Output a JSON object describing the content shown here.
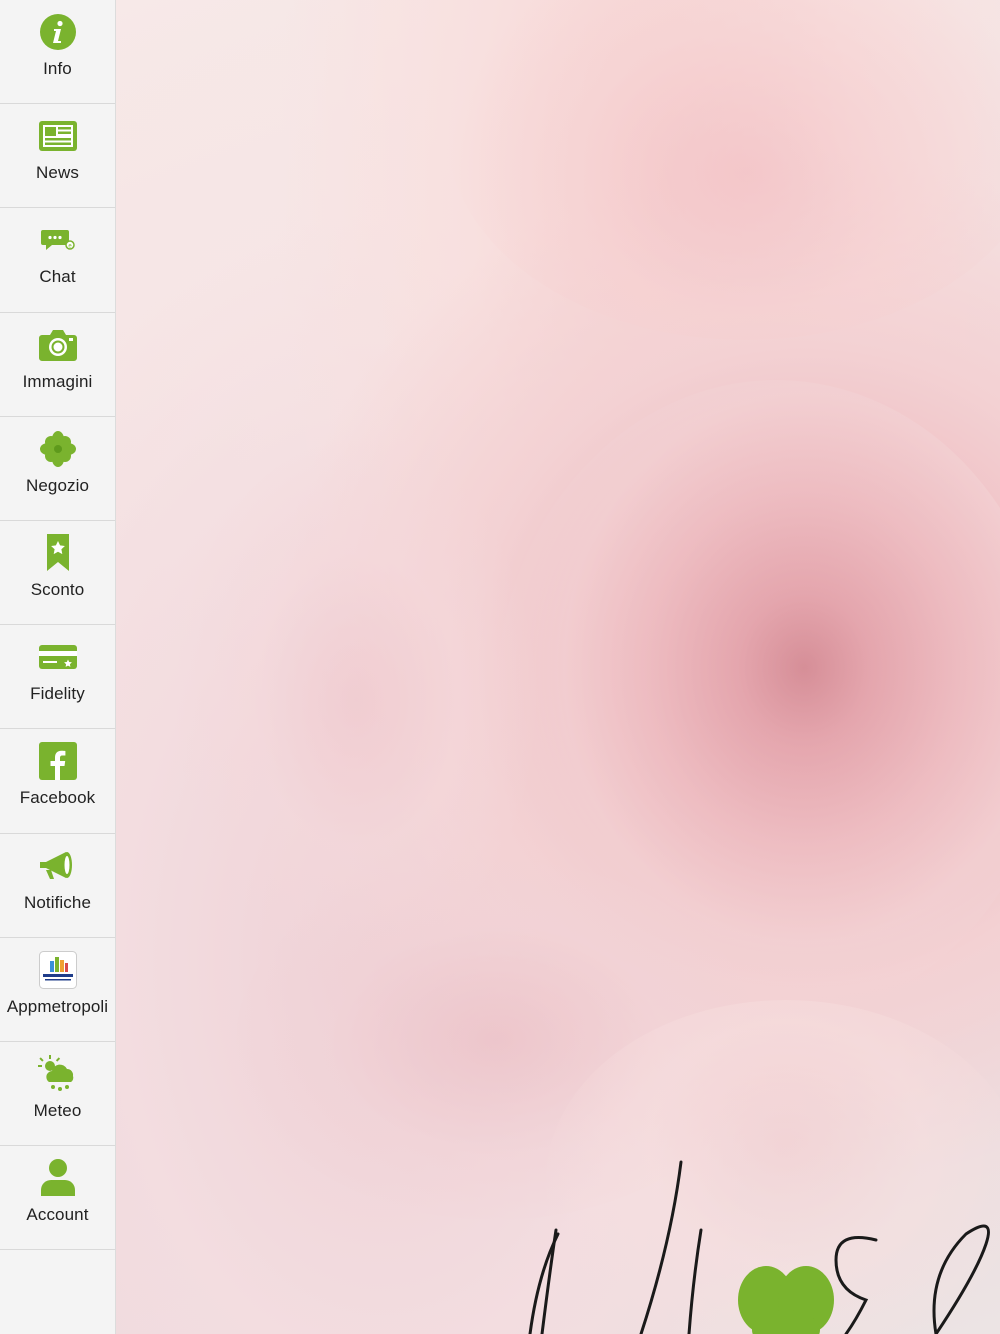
{
  "sidebar": {
    "items": [
      {
        "label": "Info",
        "icon": "info-icon"
      },
      {
        "label": "News",
        "icon": "news-icon"
      },
      {
        "label": "Chat",
        "icon": "chat-icon"
      },
      {
        "label": "Immagini",
        "icon": "camera-icon"
      },
      {
        "label": "Negozio",
        "icon": "flower-icon"
      },
      {
        "label": "Sconto",
        "icon": "bookmark-star-icon"
      },
      {
        "label": "Fidelity",
        "icon": "card-icon"
      },
      {
        "label": "Facebook",
        "icon": "facebook-icon"
      },
      {
        "label": "Notifiche",
        "icon": "megaphone-icon"
      },
      {
        "label": "Appmetropoli",
        "icon": "appmetropoli-logo-icon"
      },
      {
        "label": "Meteo",
        "icon": "weather-icon"
      },
      {
        "label": "Account",
        "icon": "user-icon"
      }
    ]
  },
  "hero": {
    "logo_text": "il lirse"
  },
  "colors": {
    "accent": "#7ab32e",
    "sidebar_bg": "#f4f4f4",
    "label": "#222222"
  }
}
